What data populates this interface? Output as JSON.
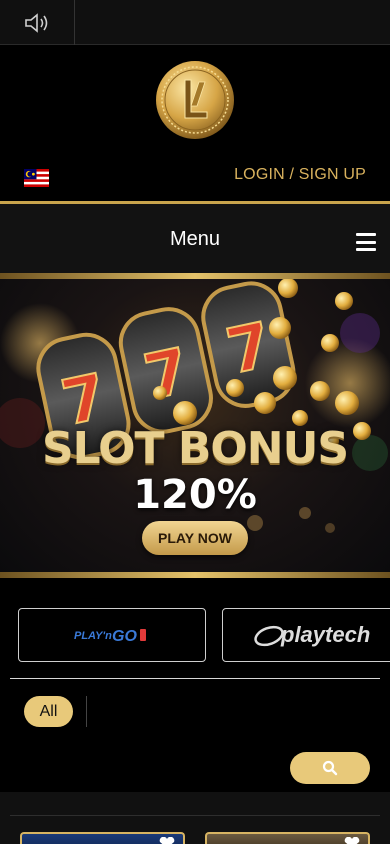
{
  "header": {
    "sound_icon": "speaker-icon",
    "logo_icon": "gold-coin-logo",
    "flag_icon": "malaysia-flag-icon",
    "login_label": "LOGIN / SIGN UP"
  },
  "menu": {
    "title": "Menu",
    "hamburger_icon": "hamburger-menu-icon"
  },
  "banner": {
    "title": "SLOT BONUS",
    "percent": "120%",
    "cta_label": "PLAY NOW"
  },
  "providers": [
    {
      "name": "PLAY'n GO"
    },
    {
      "name": "playtech"
    }
  ],
  "filters": {
    "all_label": "All"
  },
  "search": {
    "icon": "search-icon"
  },
  "games": {
    "favorite_icon": "heart-icon"
  },
  "colors": {
    "gold": "#d9b25e",
    "pill": "#e8c97a",
    "background": "#000000"
  }
}
